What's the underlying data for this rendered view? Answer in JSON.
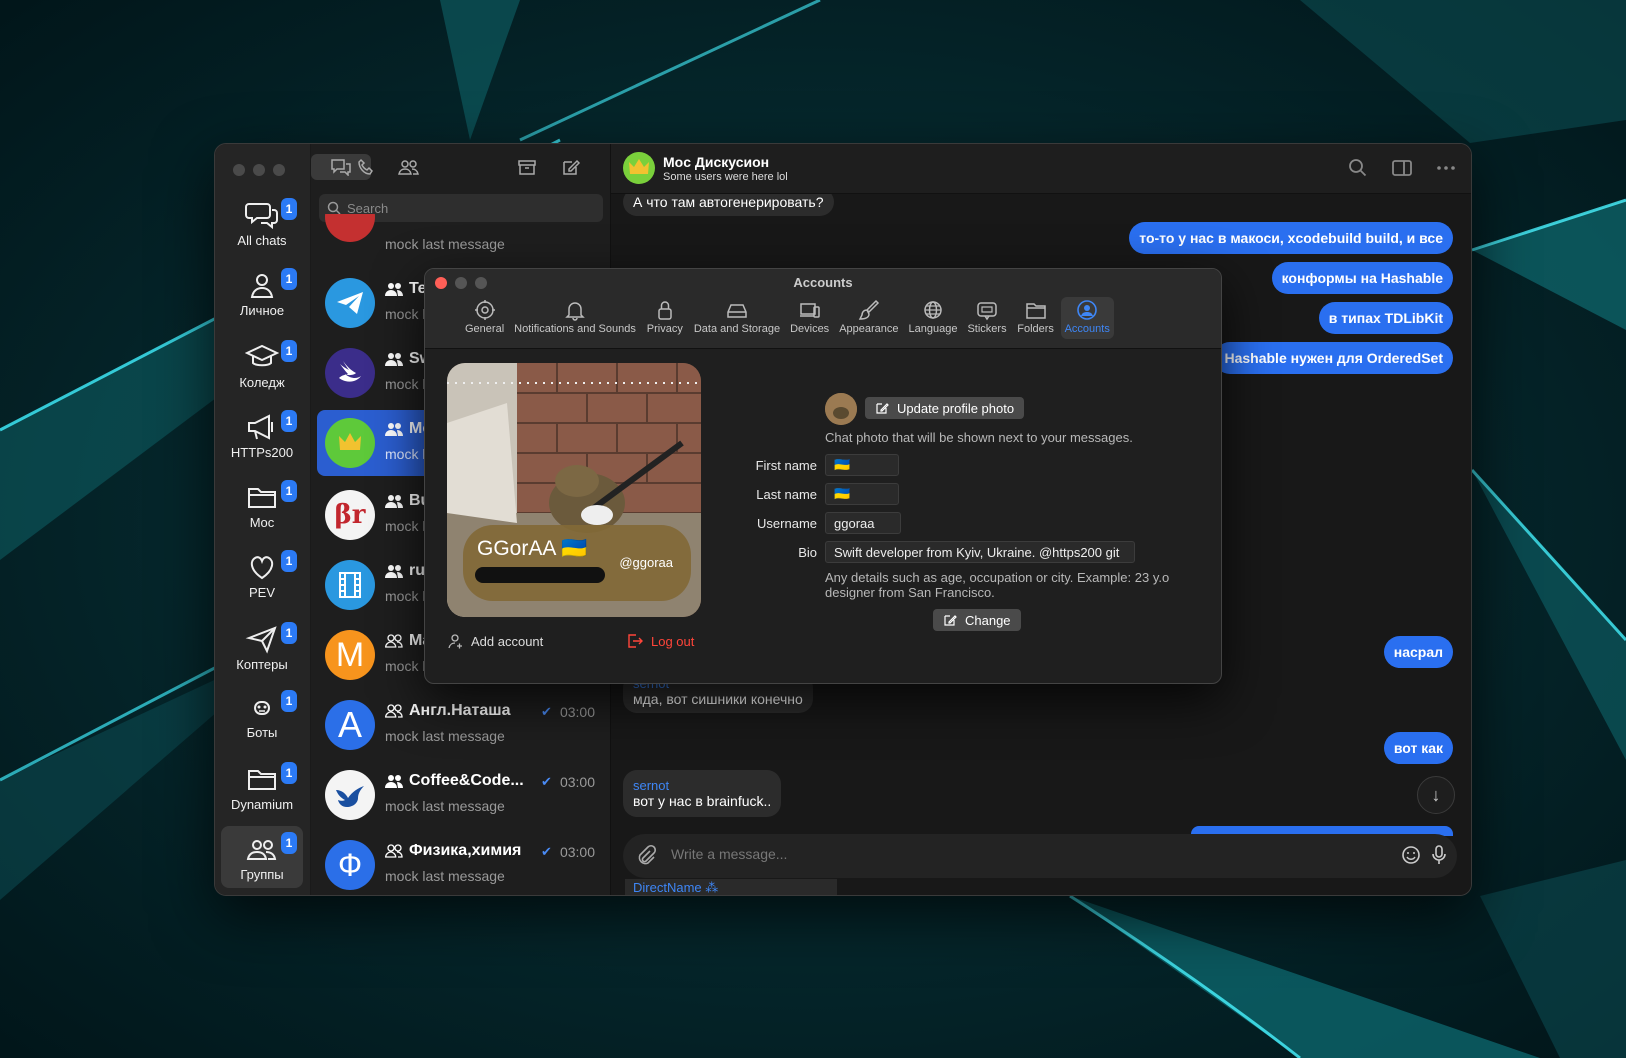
{
  "folders": [
    {
      "label": "All chats",
      "badge": "1",
      "icon": "chat-bubbles-icon"
    },
    {
      "label": "Личное",
      "badge": "1",
      "icon": "person-icon"
    },
    {
      "label": "Коледж",
      "badge": "1",
      "icon": "graduation-cap-icon"
    },
    {
      "label": "HTTPs200",
      "badge": "1",
      "icon": "megaphone-icon"
    },
    {
      "label": "Moc",
      "badge": "1",
      "icon": "folder-icon"
    },
    {
      "label": "PEV",
      "badge": "1",
      "icon": "heart-icon"
    },
    {
      "label": "Коптеры",
      "badge": "1",
      "icon": "paper-plane-icon"
    },
    {
      "label": "Боты",
      "badge": "1",
      "icon": "bot-icon"
    },
    {
      "label": "Dynamium",
      "badge": "1",
      "icon": "folder-icon"
    },
    {
      "label": "Группы",
      "badge": "1",
      "icon": "group-icon"
    }
  ],
  "search": {
    "placeholder": "Search"
  },
  "chats": [
    {
      "title": "",
      "message": "mock last message",
      "time": ""
    },
    {
      "title": "Tel",
      "message": "mock las",
      "time": ""
    },
    {
      "title": "Sw",
      "message": "mock las",
      "time": ""
    },
    {
      "title": "Mo",
      "message": "mock las",
      "time": ""
    },
    {
      "title": "Bu",
      "message": "mock las",
      "time": ""
    },
    {
      "title": "ru_",
      "message": "mock las",
      "time": ""
    },
    {
      "title": "Ma",
      "message": "mock las",
      "time": ""
    },
    {
      "title": "Англ.Наташа",
      "message": "mock last message",
      "time": "03:00"
    },
    {
      "title": "Coffee&Code...",
      "message": "mock last message",
      "time": "03:00"
    },
    {
      "title": "Физика,химия",
      "message": "mock last message",
      "time": "03:00"
    }
  ],
  "chat_avatars": [
    "",
    "",
    "",
    "",
    "βr",
    "",
    "M",
    "A",
    "",
    "Ф"
  ],
  "conversation": {
    "name": "Moc Дискусион",
    "subtitle": "Some users were here lol",
    "messages_in": [
      {
        "sender": "",
        "text": "А что там автогенерировать?"
      },
      {
        "sender": "sernot",
        "text": "мда, вот сишники конечно"
      },
      {
        "sender": "sernot",
        "text": "вот у нас в brainfuck.."
      }
    ],
    "messages_out": [
      "то-то у нас в макоси, xcodebuild build, и все",
      "конформы на Hashable",
      "в типах TDLibKit",
      "Hashable нужен для OrderedSet",
      "насрал",
      "вот как"
    ],
    "composer_placeholder": "Write a message...",
    "direct_name": "DirectName"
  },
  "settings": {
    "title": "Accounts",
    "tabs": [
      "General",
      "Notifications and Sounds",
      "Privacy",
      "Data and Storage",
      "Devices",
      "Appearance",
      "Language",
      "Stickers",
      "Folders",
      "Accounts"
    ],
    "profile_card": {
      "name": "GGorAA 🇺🇦",
      "username": "@ggoraa"
    },
    "update_photo": "Update profile photo",
    "photo_hint": "Chat photo that will be shown next to your messages.",
    "first_name_label": "First name",
    "first_name": "🇺🇦",
    "last_name_label": "Last name",
    "last_name": "🇺🇦",
    "username_label": "Username",
    "username": "ggoraa",
    "bio_label": "Bio",
    "bio": "Swift developer from Kyiv, Ukraine. @https200 git",
    "bio_hint_1": "Any details such as age, occupation or city. Example: 23 y.o",
    "bio_hint_2": "designer from San Francisco.",
    "change": "Change",
    "add_account": "Add account",
    "log_out": "Log out"
  },
  "colors": {
    "accent": "#2a6ff0",
    "destructive": "#ff453a",
    "selected_row": "#2b5ed0"
  }
}
